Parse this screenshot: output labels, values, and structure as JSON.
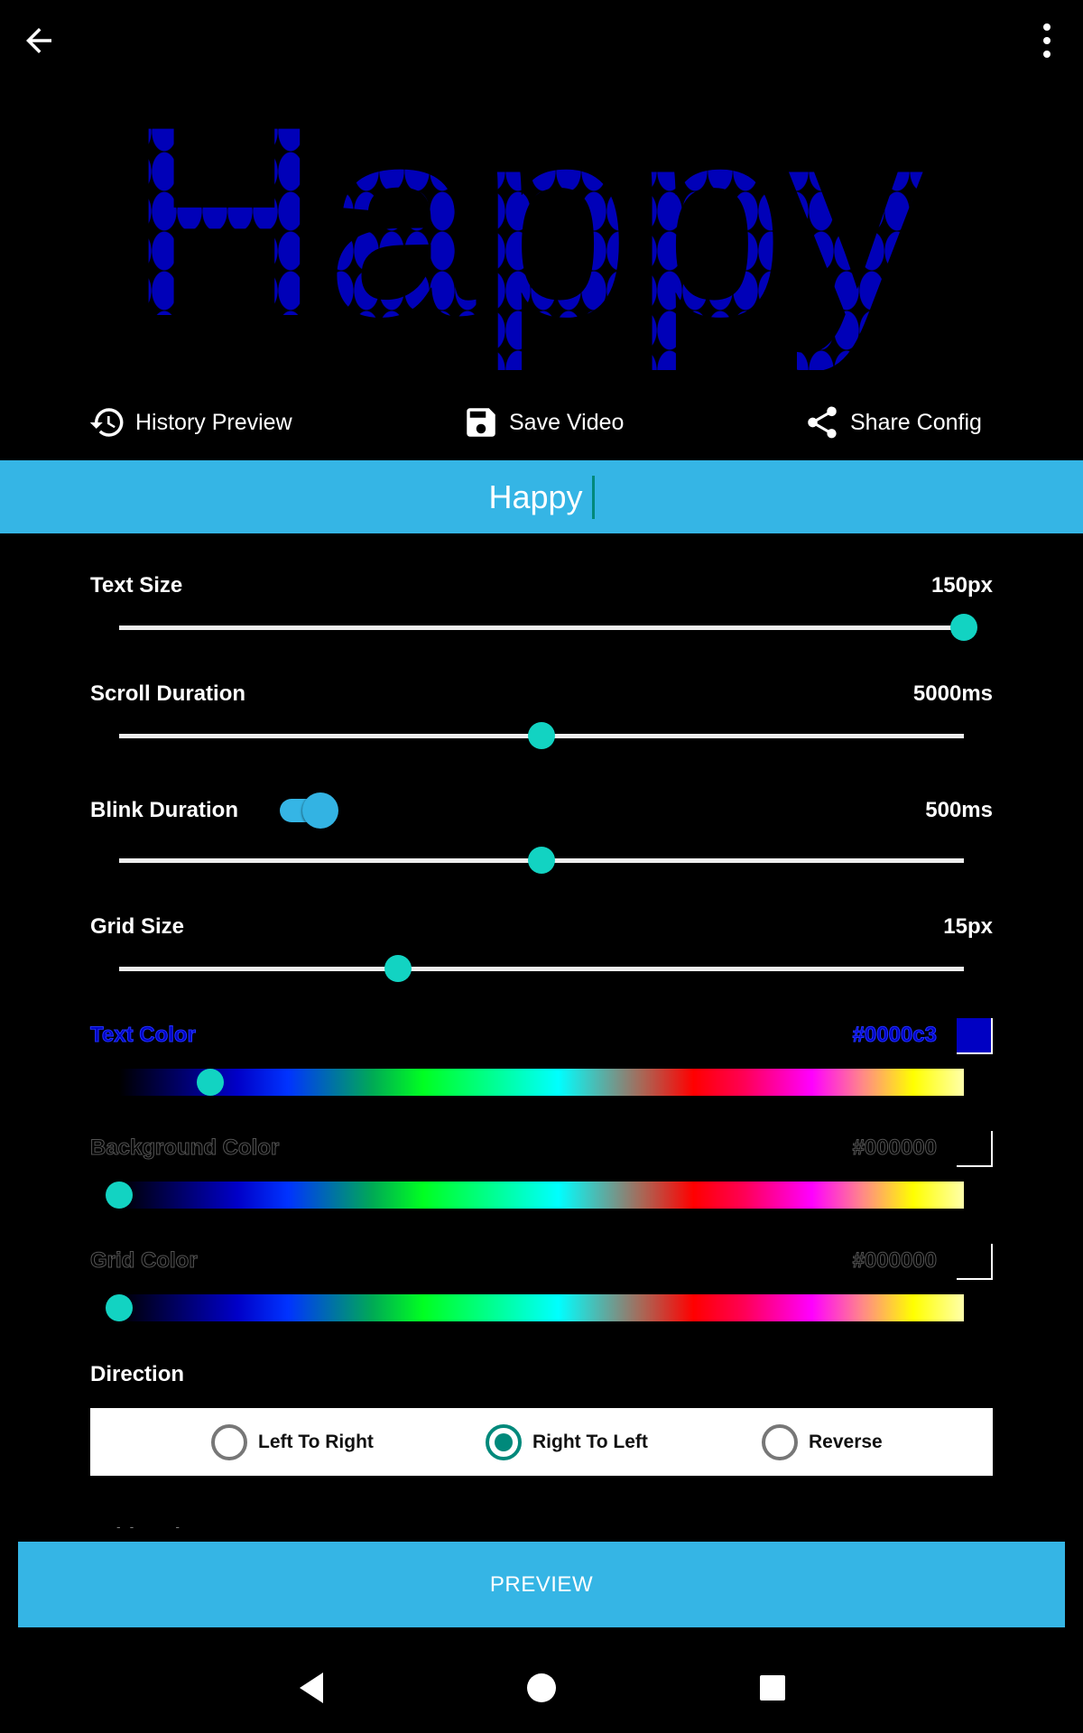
{
  "topbar": {
    "back_icon": "arrow-left-icon",
    "menu_icon": "more-vertical-icon"
  },
  "preview": {
    "text": "Happy",
    "text_color": "#0000c3",
    "background_color": "#000000"
  },
  "actions": [
    {
      "label": "History Preview",
      "icon": "history-icon"
    },
    {
      "label": "Save Video",
      "icon": "save-icon"
    },
    {
      "label": "Share Config",
      "icon": "share-icon"
    }
  ],
  "text_input": {
    "value": "Happy"
  },
  "settings": {
    "text_size": {
      "label": "Text Size",
      "value": "150px",
      "fraction": 1.0
    },
    "scroll_duration": {
      "label": "Scroll Duration",
      "value": "5000ms",
      "fraction": 0.5
    },
    "blink_duration": {
      "label": "Blink Duration",
      "value": "500ms",
      "fraction": 0.5,
      "enabled": true
    },
    "grid_size": {
      "label": "Grid Size",
      "value": "15px",
      "fraction": 0.33
    }
  },
  "colors": {
    "text_color": {
      "label": "Text Color",
      "hex": "#0000c3",
      "fraction": 0.108
    },
    "background_color": {
      "label": "Background Color",
      "hex": "#000000",
      "fraction": 0.0
    },
    "grid_color": {
      "label": "Grid Color",
      "hex": "#000000",
      "fraction": 0.0
    }
  },
  "direction": {
    "label": "Direction",
    "options": [
      "Left To Right",
      "Right To Left",
      "Reverse"
    ],
    "selected": "Right To Left"
  },
  "next_section_label": "Grid Style",
  "preview_button": {
    "label": "PREVIEW"
  },
  "system_nav": {
    "back": "nav-back-icon",
    "home": "nav-home-icon",
    "recents": "nav-recents-icon"
  },
  "theme": {
    "accent": "#35b5e5",
    "thumb": "#12d3c2",
    "radio_selected": "#00897b"
  }
}
